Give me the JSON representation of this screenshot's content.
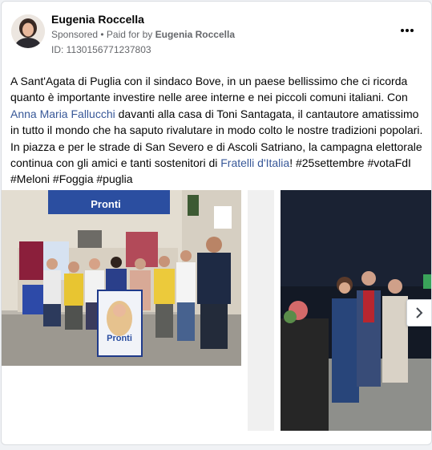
{
  "post": {
    "author": "Eugenia Roccella",
    "sponsored_label": "Sponsored",
    "separator": " • ",
    "paid_for_prefix": "Paid for by ",
    "paid_for_name": "Eugenia Roccella",
    "id_label": "ID: 1130156771237803",
    "text_1": "A Sant'Agata di Puglia con il sindaco Bove, in un paese bellissimo che ci ricorda quanto è importante investire nelle aree interne e nei piccoli comuni italiani. Con ",
    "mention_1": "Anna Maria Fallucchi",
    "text_2": " davanti alla casa di Toni Santagata, il cantautore amatissimo in tutto il mondo che ha saputo rivalutare in modo colto le nostre tradizioni popolari. In piazza e per le strade di San Severo e di Ascoli Satriano, la campagna elettorale continua con gli amici e tanti sostenitori di ",
    "mention_2": "Fratelli d'Italia",
    "text_3": "! ",
    "hashtags": "#25settembre #votaFdI #Meloni #Foggia #puglia"
  },
  "photos": {
    "banner_text": "Pronti",
    "poster_text": "Pronti"
  },
  "icons": {
    "more": "more-options-icon",
    "next": "chevron-right-icon"
  },
  "colors": {
    "link": "#385898",
    "secondary_text": "#65676b",
    "banner_blue": "#2b4ea0"
  }
}
